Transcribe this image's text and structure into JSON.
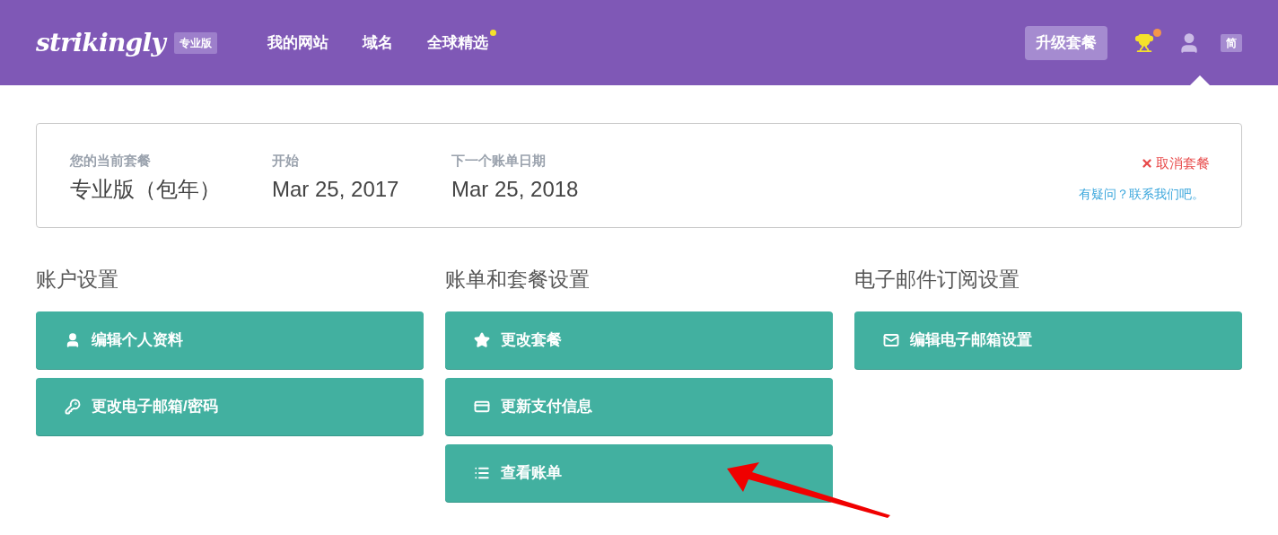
{
  "header": {
    "logo": "strikingly",
    "plan_badge": "专业版",
    "nav": [
      {
        "label": "我的网站",
        "notice": false
      },
      {
        "label": "域名",
        "notice": false
      },
      {
        "label": "全球精选",
        "notice": true
      }
    ],
    "upgrade_button": "升级套餐",
    "trophy_notice": true,
    "language": "简"
  },
  "plan": {
    "fields": [
      {
        "label": "您的当前套餐",
        "value": "专业版（包年）"
      },
      {
        "label": "开始",
        "value": "Mar 25, 2017"
      },
      {
        "label": "下一个账单日期",
        "value": "Mar 25, 2018"
      }
    ],
    "cancel": "取消套餐",
    "help_link": "有疑问？联系我们吧。"
  },
  "sections": [
    {
      "title": "账户设置",
      "buttons": [
        {
          "label": "编辑个人资料",
          "kind": "user"
        },
        {
          "label": "更改电子邮箱/密码",
          "kind": "key"
        }
      ]
    },
    {
      "title": "账单和套餐设置",
      "buttons": [
        {
          "label": "更改套餐",
          "kind": "star"
        },
        {
          "label": "更新支付信息",
          "kind": "card"
        },
        {
          "label": "查看账单",
          "kind": "list"
        }
      ]
    },
    {
      "title": "电子邮件订阅设置",
      "buttons": [
        {
          "label": "编辑电子邮箱设置",
          "kind": "mail"
        }
      ]
    }
  ]
}
